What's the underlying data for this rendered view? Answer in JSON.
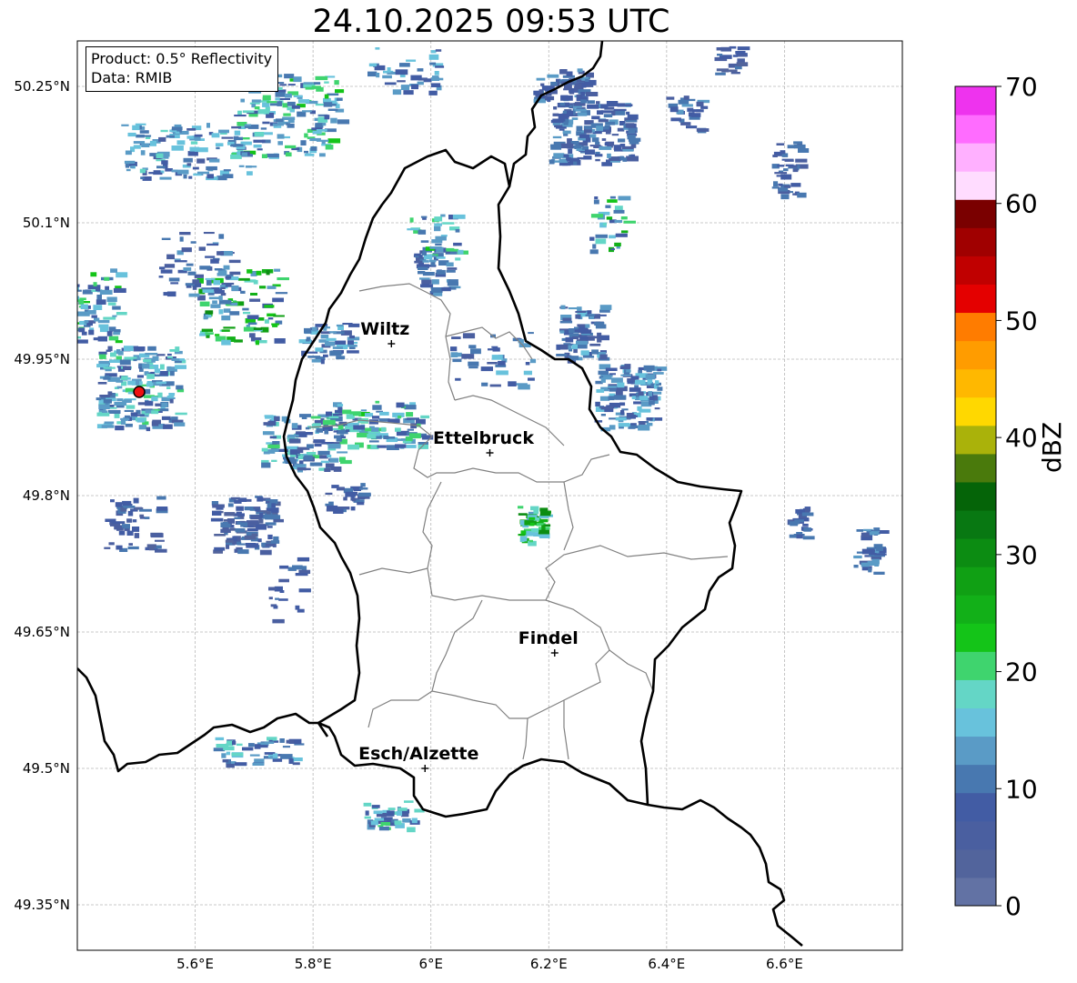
{
  "header": {
    "title": "24.10.2025 09:53 UTC"
  },
  "info_box": {
    "product": "Product: 0.5° Reflectivity",
    "data_source": "Data: RMIB"
  },
  "map": {
    "extent": {
      "lon": [
        5.4,
        6.8
      ],
      "lat": [
        49.3,
        50.3
      ]
    },
    "lon_ticks": [
      {
        "value": 5.6,
        "label": "5.6°E"
      },
      {
        "value": 5.8,
        "label": "5.8°E"
      },
      {
        "value": 6.0,
        "label": "6°E"
      },
      {
        "value": 6.2,
        "label": "6.2°E"
      },
      {
        "value": 6.4,
        "label": "6.4°E"
      },
      {
        "value": 6.6,
        "label": "6.6°E"
      }
    ],
    "lat_ticks": [
      {
        "value": 50.25,
        "label": "50.25°N"
      },
      {
        "value": 50.1,
        "label": "50.1°N"
      },
      {
        "value": 49.95,
        "label": "49.95°N"
      },
      {
        "value": 49.8,
        "label": "49.8°N"
      },
      {
        "value": 49.65,
        "label": "49.65°N"
      },
      {
        "value": 49.5,
        "label": "49.5°N"
      },
      {
        "value": 49.35,
        "label": "49.35°N"
      }
    ],
    "cities": [
      {
        "name": "Wiltz",
        "lon": 5.933,
        "lat": 49.967
      },
      {
        "name": "Ettelbruck",
        "lon": 6.1,
        "lat": 49.847
      },
      {
        "name": "Findel",
        "lon": 6.21,
        "lat": 49.627
      },
      {
        "name": "Esch/Alzette",
        "lon": 5.99,
        "lat": 49.5
      }
    ],
    "radar_site": {
      "lon": 5.505,
      "lat": 49.914
    },
    "grid": true
  },
  "colorbar": {
    "label": "dBZ",
    "range": [
      0,
      70
    ],
    "ticks": [
      "0",
      "10",
      "20",
      "30",
      "40",
      "50",
      "60",
      "70"
    ],
    "colors": [
      "#6272a4",
      "#52649c",
      "#4a5fa0",
      "#425ca4",
      "#4878b0",
      "#5a9bc6",
      "#68c2dc",
      "#64d6c6",
      "#3fd46e",
      "#14c418",
      "#12b018",
      "#10a014",
      "#0c8c12",
      "#087812",
      "#056408",
      "#4a7a0c",
      "#aab20a",
      "#ffd800",
      "#ffb800",
      "#ff9c00",
      "#ff7c00",
      "#e40000",
      "#c00000",
      "#a00000",
      "#7a0000",
      "#ffdcff",
      "#ffb0ff",
      "#ff6cff",
      "#ee33ee"
    ]
  }
}
